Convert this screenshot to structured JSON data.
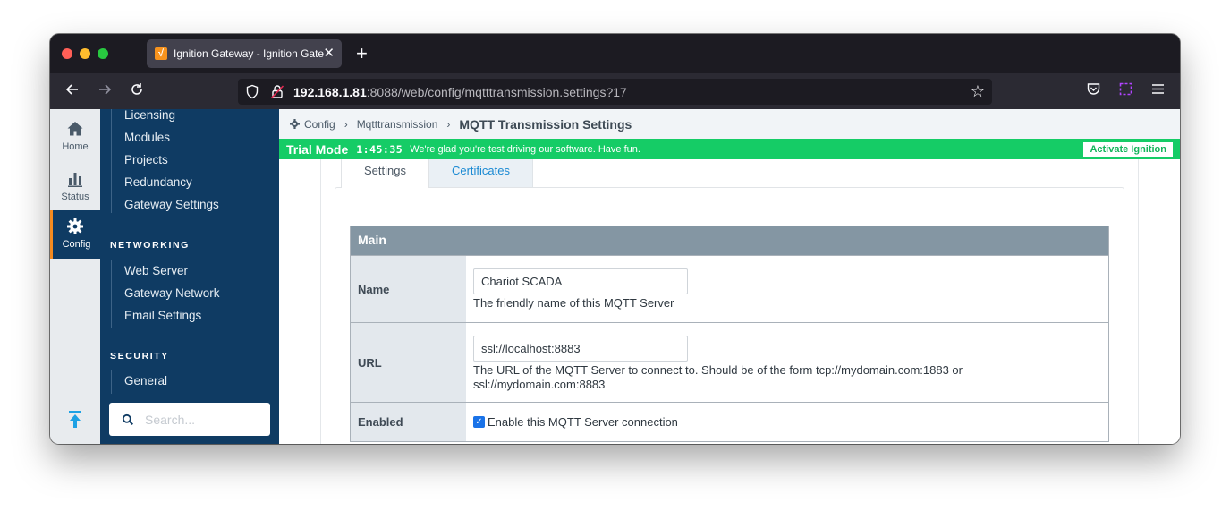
{
  "browser": {
    "tab_title": "Ignition Gateway - Ignition Gateway",
    "tab_favicon": "√",
    "url_host": "192.168.1.81",
    "url_rest": ":8088/web/config/mqtttransmission.settings?17"
  },
  "rail": {
    "items": [
      {
        "label": "Home",
        "icon": "home-icon"
      },
      {
        "label": "Status",
        "icon": "bar-chart-icon"
      },
      {
        "label": "Config",
        "icon": "gear-icon",
        "active": true
      }
    ]
  },
  "sidebar": {
    "system_links": [
      "Licensing",
      "Modules",
      "Projects",
      "Redundancy",
      "Gateway Settings"
    ],
    "networking_heading": "NETWORKING",
    "networking_links": [
      "Web Server",
      "Gateway Network",
      "Email Settings"
    ],
    "security_heading": "SECURITY",
    "security_links": [
      "General"
    ],
    "search_placeholder": "Search..."
  },
  "breadcrumb": {
    "root": "Config",
    "section": "Mqtttransmission",
    "current": "MQTT Transmission Settings"
  },
  "trial": {
    "label": "Trial Mode",
    "timer": "1:45:35",
    "message": "We're glad you're test driving our software. Have fun.",
    "button": "Activate Ignition"
  },
  "tabs": {
    "settings": "Settings",
    "certificates": "Certificates"
  },
  "form": {
    "section_title": "Main",
    "name_label": "Name",
    "name_value": "Chariot SCADA",
    "name_help": "The friendly name of this MQTT Server",
    "url_label": "URL",
    "url_value": "ssl://localhost:8883",
    "url_help": "The URL of the MQTT Server to connect to. Should be of the form tcp://mydomain.com:1883 or ssl://mydomain.com:8883",
    "enabled_label": "Enabled",
    "enabled_text": "Enable this MQTT Server connection",
    "enabled_checked": true
  },
  "colors": {
    "sidebar": "#0f3b63",
    "trial_banner": "#15cc66",
    "accent_link": "#1b8ad3",
    "active_marker": "#f68b1f"
  }
}
